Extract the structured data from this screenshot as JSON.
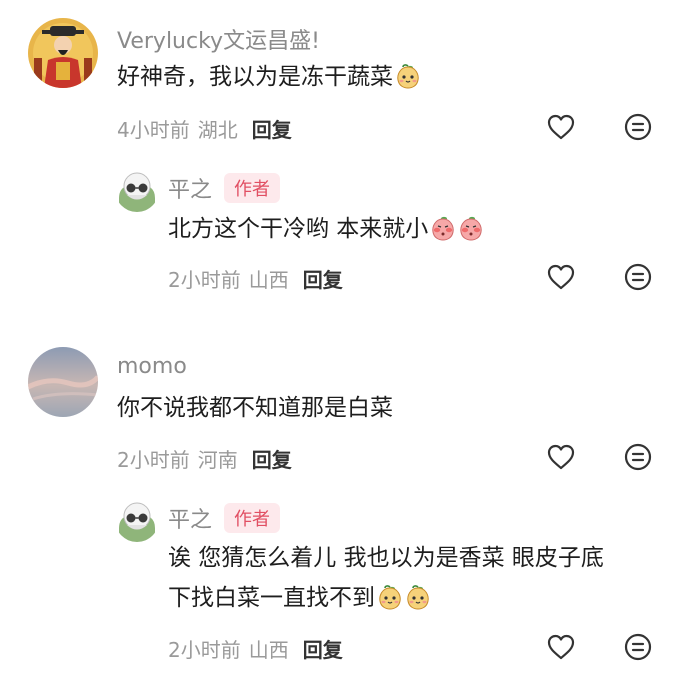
{
  "comments": [
    {
      "username": "Verylucky文运昌盛!",
      "text": "好神奇，我以为是冻干蔬菜",
      "emojis": [
        "peach-face-emoji"
      ],
      "time": "4小时前",
      "location": "湖北",
      "reply_label": "回复",
      "replies": [
        {
          "username": "平之",
          "badge": "作者",
          "text": "北方这个干冷哟 本来就小",
          "emojis": [
            "blushing-peach-emoji",
            "blushing-peach-emoji"
          ],
          "time": "2小时前",
          "location": "山西",
          "reply_label": "回复"
        }
      ]
    },
    {
      "username": "momo",
      "text": "你不说我都不知道那是白菜",
      "time": "2小时前",
      "location": "河南",
      "reply_label": "回复",
      "replies": [
        {
          "username": "平之",
          "badge": "作者",
          "text_line1": "诶 您猜怎么着儿 我也以为是香菜 眼皮子底",
          "text_line2": "下找白菜一直找不到",
          "emojis": [
            "peach-face-emoji",
            "peach-face-emoji"
          ],
          "time": "2小时前",
          "location": "山西",
          "reply_label": "回复"
        }
      ]
    }
  ],
  "icons": {
    "like": "heart-outline-icon",
    "menu": "comment-menu-icon"
  }
}
